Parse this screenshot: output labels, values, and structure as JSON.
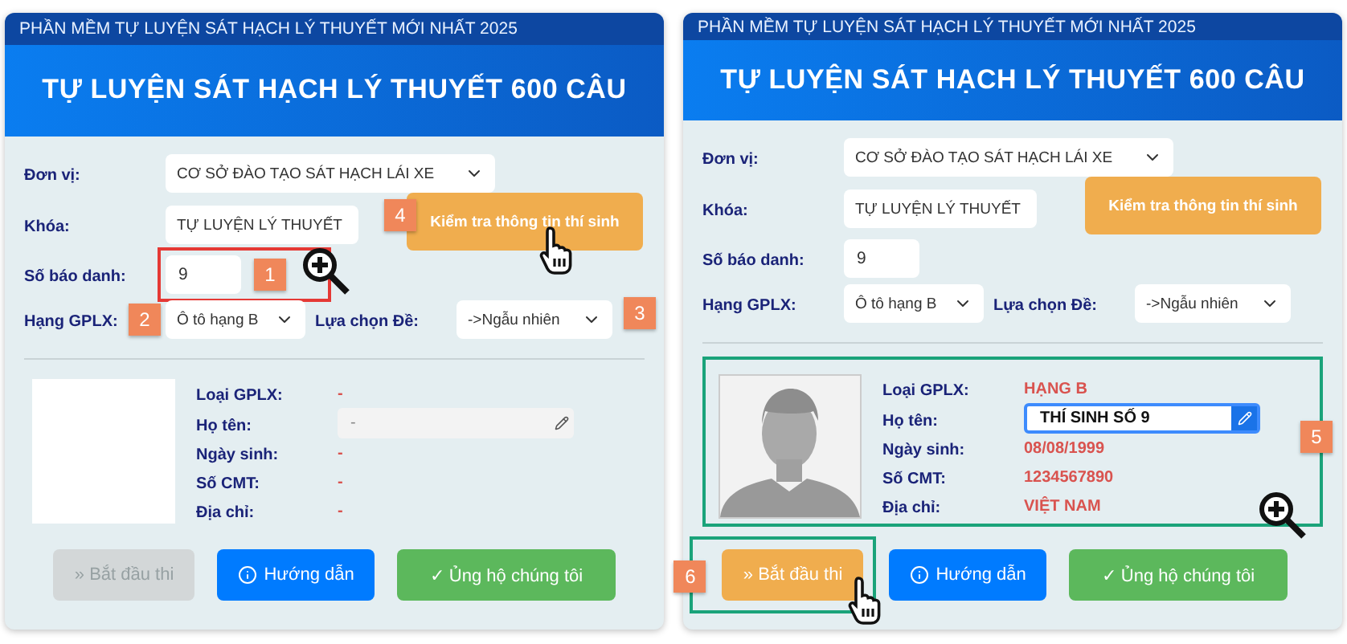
{
  "panels": [
    {
      "top_bar": "PHẦN MỀM TỰ LUYỆN SÁT HẠCH LÝ THUYẾT MỚI NHẤT 2025",
      "title": "TỰ LUYỆN SÁT HẠCH LÝ THUYẾT 600 CÂU",
      "form": {
        "unit": {
          "label": "Đơn vị:",
          "value": "CƠ SỞ ĐÀO TẠO SÁT HẠCH LÁI XE"
        },
        "course": {
          "label": "Khóa:",
          "value": "TỰ LUYỆN LÝ THUYẾT"
        },
        "check_button": {
          "label": "Kiểm tra thông tin thí sinh",
          "badge": "4",
          "hand_cursor": true
        },
        "candidate_number": {
          "label": "Số báo danh:",
          "value": "9",
          "highlight": {
            "color": "#e53935"
          },
          "badge": "1",
          "magnifier": true
        },
        "license_class": {
          "label": "Hạng GPLX:",
          "value": "Ô tô hạng B",
          "badge": "2"
        },
        "exam_choice": {
          "label": "Lựa chọn Đề:",
          "value": "->Ngẫu nhiên",
          "badge": "3"
        }
      },
      "info": {
        "has_photo": false,
        "rows": [
          {
            "kind": "text",
            "label": "Loại GPLX:",
            "value": "-"
          },
          {
            "kind": "name_field",
            "label": "Họ tên:",
            "value": "-",
            "disabled": true
          },
          {
            "kind": "text",
            "label": "Ngày sinh:",
            "value": "-"
          },
          {
            "kind": "text",
            "label": "Số CMT:",
            "value": "-"
          },
          {
            "kind": "text",
            "label": "Địa chỉ:",
            "value": "-"
          }
        ]
      },
      "buttons": [
        {
          "kind": "start",
          "label": "» Bắt đầu thi",
          "disabled": true
        },
        {
          "kind": "guide",
          "label": "Hướng dẫn",
          "disabled": false
        },
        {
          "kind": "support",
          "label": "✓ Ủng hộ chúng tôi",
          "disabled": false
        }
      ]
    },
    {
      "top_bar": "PHẦN MỀM TỰ LUYỆN SÁT HẠCH LÝ THUYẾT MỚI NHẤT 2025",
      "title": "TỰ LUYỆN SÁT HẠCH LÝ THUYẾT 600 CÂU",
      "form": {
        "unit": {
          "label": "Đơn vị:",
          "value": "CƠ SỞ ĐÀO TẠO SÁT HẠCH LÁI XE"
        },
        "course": {
          "label": "Khóa:",
          "value": "TỰ LUYỆN LÝ THUYẾT"
        },
        "check_button": {
          "label": "Kiểm tra thông tin thí sinh"
        },
        "candidate_number": {
          "label": "Số báo danh:",
          "value": "9"
        },
        "license_class": {
          "label": "Hạng GPLX:",
          "value": "Ô tô hạng B"
        },
        "exam_choice": {
          "label": "Lựa chọn Đề:",
          "value": "->Ngẫu nhiên"
        }
      },
      "info": {
        "has_photo": true,
        "highlight": {
          "color": "#1aa37a"
        },
        "badge": "5",
        "magnifier": true,
        "rows": [
          {
            "kind": "text",
            "label": "Loại GPLX:",
            "value": "HẠNG B"
          },
          {
            "kind": "name_field",
            "label": "Họ tên:",
            "value": "THÍ SINH SỐ 9",
            "disabled": false
          },
          {
            "kind": "text",
            "label": "Ngày sinh:",
            "value": "08/08/1999"
          },
          {
            "kind": "text",
            "label": "Số CMT:",
            "value": "1234567890"
          },
          {
            "kind": "text",
            "label": "Địa chỉ:",
            "value": "VIỆT NAM"
          }
        ]
      },
      "buttons": [
        {
          "kind": "start",
          "label": "» Bắt đầu thi",
          "disabled": false,
          "highlight": {
            "color": "#1aa37a"
          },
          "badge": "6",
          "hand_cursor": true
        },
        {
          "kind": "guide",
          "label": "Hướng dẫn",
          "disabled": false
        },
        {
          "kind": "support",
          "label": "✓ Ủng hộ chúng tôi",
          "disabled": false
        }
      ]
    }
  ]
}
